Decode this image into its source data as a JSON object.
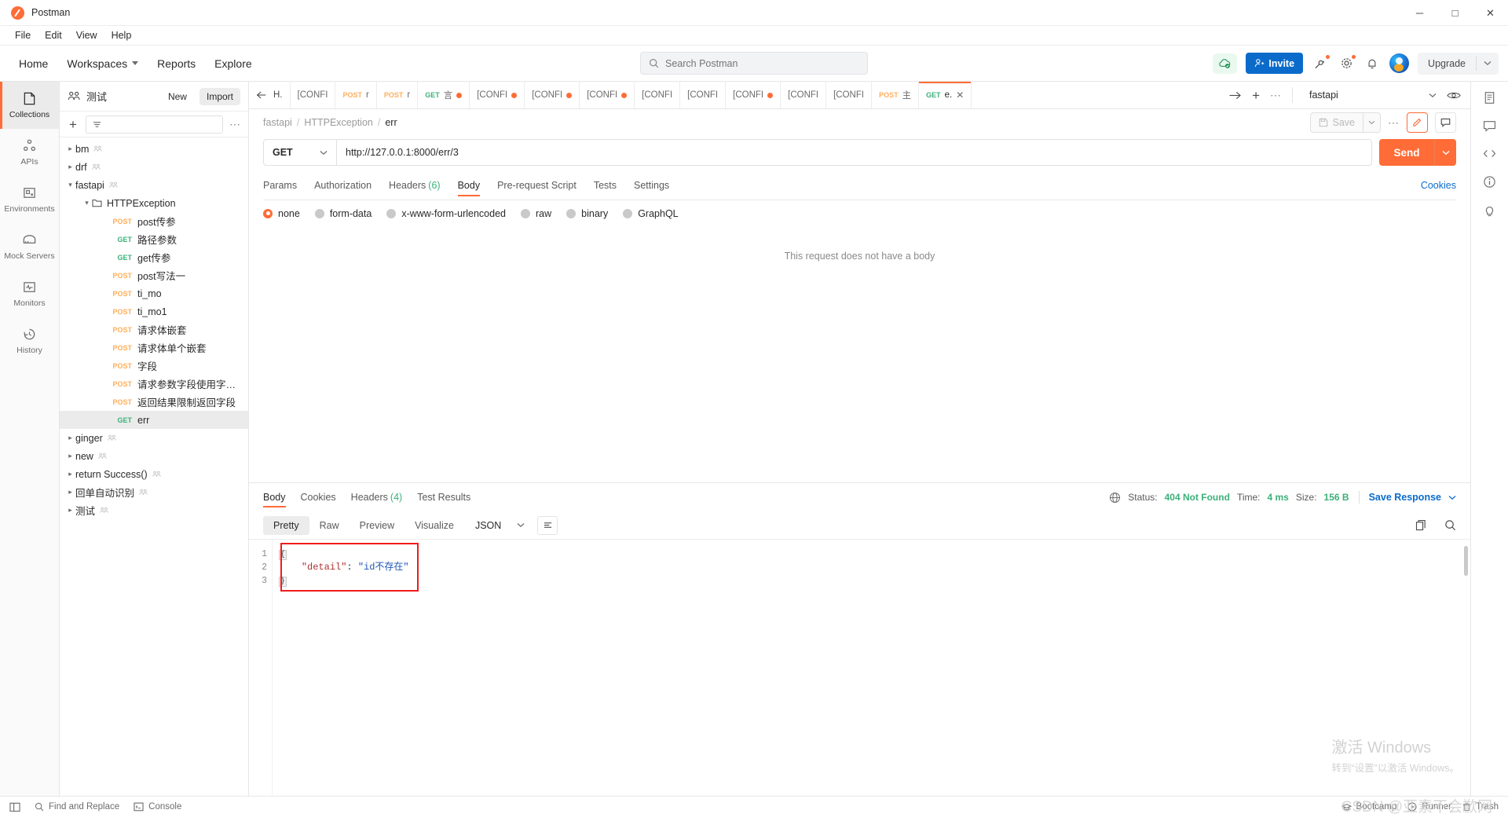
{
  "window": {
    "app_title": "Postman",
    "minimize": "─",
    "maximize": "□",
    "close": "✕"
  },
  "menubar": {
    "items": [
      "File",
      "Edit",
      "View",
      "Help"
    ]
  },
  "topnav": {
    "links": [
      "Home",
      "Workspaces",
      "Reports",
      "Explore"
    ],
    "search_placeholder": "Search Postman",
    "invite_label": "Invite",
    "upgrade_label": "Upgrade"
  },
  "rail": {
    "items": [
      {
        "label": "Collections",
        "icon": "collections-icon",
        "active": true
      },
      {
        "label": "APIs",
        "icon": "apis-icon",
        "active": false
      },
      {
        "label": "Environments",
        "icon": "environments-icon",
        "active": false
      },
      {
        "label": "Mock Servers",
        "icon": "mock-servers-icon",
        "active": false
      },
      {
        "label": "Monitors",
        "icon": "monitors-icon",
        "active": false
      },
      {
        "label": "History",
        "icon": "history-icon",
        "active": false
      }
    ]
  },
  "sidebar": {
    "workspace_name": "测试",
    "new_label": "New",
    "import_label": "Import",
    "filter_placeholder": "",
    "tree": [
      {
        "indent": 0,
        "chevron": "›",
        "label": "bm",
        "shared": true
      },
      {
        "indent": 0,
        "chevron": "›",
        "label": "drf",
        "shared": true
      },
      {
        "indent": 0,
        "chevron": "⌄",
        "label": "fastapi",
        "shared": true
      },
      {
        "indent": 1,
        "chevron": "⌄",
        "label": "HTTPException",
        "folder": true
      },
      {
        "indent": 2,
        "method": "POST",
        "label": "post传参"
      },
      {
        "indent": 2,
        "method": "GET",
        "label": "路径参数"
      },
      {
        "indent": 2,
        "method": "GET",
        "label": "get传参"
      },
      {
        "indent": 2,
        "method": "POST",
        "label": "post写法一"
      },
      {
        "indent": 2,
        "method": "POST",
        "label": "ti_mo"
      },
      {
        "indent": 2,
        "method": "POST",
        "label": "ti_mo1"
      },
      {
        "indent": 2,
        "method": "POST",
        "label": "请求体嵌套"
      },
      {
        "indent": 2,
        "method": "POST",
        "label": "请求体单个嵌套"
      },
      {
        "indent": 2,
        "method": "POST",
        "label": "字段"
      },
      {
        "indent": 2,
        "method": "POST",
        "label": "请求参数字段使用字典列表集合..."
      },
      {
        "indent": 2,
        "method": "POST",
        "label": "返回结果限制返回字段"
      },
      {
        "indent": 2,
        "method": "GET",
        "label": "err",
        "selected": true
      },
      {
        "indent": 0,
        "chevron": "›",
        "label": "ginger",
        "shared": true
      },
      {
        "indent": 0,
        "chevron": "›",
        "label": "new",
        "shared": true
      },
      {
        "indent": 0,
        "chevron": "›",
        "label": "return Success()",
        "shared": true
      },
      {
        "indent": 0,
        "chevron": "›",
        "label": "回单自动识别",
        "shared": true
      },
      {
        "indent": 0,
        "chevron": "›",
        "label": "测试",
        "shared": true
      }
    ]
  },
  "tabstrip": {
    "back_label": "H.",
    "tabs": [
      {
        "title": "[CONFI",
        "dot": false
      },
      {
        "method": "POST",
        "title": "r",
        "dot": false
      },
      {
        "method": "POST",
        "title": "r",
        "dot": false
      },
      {
        "method": "GET",
        "title": "言",
        "dot": true
      },
      {
        "title": "[CONFI",
        "dot": true
      },
      {
        "title": "[CONFI",
        "dot": true
      },
      {
        "title": "[CONFI",
        "dot": true
      },
      {
        "title": "[CONFI",
        "dot": false
      },
      {
        "title": "[CONFI",
        "dot": false
      },
      {
        "title": "[CONFI",
        "dot": true
      },
      {
        "title": "[CONFI",
        "dot": false
      },
      {
        "title": "[CONFI",
        "dot": false
      },
      {
        "method": "POST",
        "title": "主",
        "dot": false
      },
      {
        "method": "GET",
        "title": "e.",
        "dot": false,
        "active": true,
        "closable": true
      }
    ],
    "environment": "fastapi"
  },
  "request": {
    "breadcrumb": [
      "fastapi",
      "HTTPException",
      "err"
    ],
    "save_label": "Save",
    "method": "GET",
    "url": "http://127.0.0.1:8000/err/3",
    "send_label": "Send",
    "tabs": [
      {
        "label": "Params",
        "count": null,
        "active": false
      },
      {
        "label": "Authorization",
        "count": null,
        "active": false
      },
      {
        "label": "Headers",
        "count": "(6)",
        "active": false
      },
      {
        "label": "Body",
        "count": null,
        "active": true
      },
      {
        "label": "Pre-request Script",
        "count": null,
        "active": false
      },
      {
        "label": "Tests",
        "count": null,
        "active": false
      },
      {
        "label": "Settings",
        "count": null,
        "active": false
      }
    ],
    "cookies_link": "Cookies",
    "body_options": [
      {
        "label": "none",
        "selected": true
      },
      {
        "label": "form-data",
        "selected": false
      },
      {
        "label": "x-www-form-urlencoded",
        "selected": false
      },
      {
        "label": "raw",
        "selected": false
      },
      {
        "label": "binary",
        "selected": false
      },
      {
        "label": "GraphQL",
        "selected": false
      }
    ],
    "empty_body_message": "This request does not have a body"
  },
  "response": {
    "tabs": [
      {
        "label": "Body",
        "count": null,
        "active": true
      },
      {
        "label": "Cookies",
        "count": null,
        "active": false
      },
      {
        "label": "Headers",
        "count": "(4)",
        "active": false
      },
      {
        "label": "Test Results",
        "count": null,
        "active": false
      }
    ],
    "status_label": "Status:",
    "status_value": "404 Not Found",
    "time_label": "Time:",
    "time_value": "4 ms",
    "size_label": "Size:",
    "size_value": "156 B",
    "save_response": "Save Response",
    "view_modes": [
      {
        "label": "Pretty",
        "active": true
      },
      {
        "label": "Raw",
        "active": false
      },
      {
        "label": "Preview",
        "active": false
      },
      {
        "label": "Visualize",
        "active": false
      }
    ],
    "format": "JSON",
    "body_lines": [
      {
        "num": "1",
        "fold": "−",
        "text": "{",
        "type": "punct"
      },
      {
        "num": "2",
        "key": "\"detail\"",
        "sep": ": ",
        "value": "\"id不存在\""
      },
      {
        "num": "3",
        "fold": "−",
        "text": "}",
        "type": "punct"
      }
    ]
  },
  "watermark": {
    "line1": "激活 Windows",
    "line2": "转到“设置”以激活 Windows。",
    "csdn": "CSDN @亚素不会歉网"
  },
  "bottombar": {
    "find_replace": "Find and Replace",
    "console": "Console",
    "bootcamp": "Bootcamp",
    "runner": "Runner",
    "trash": "Trash"
  }
}
